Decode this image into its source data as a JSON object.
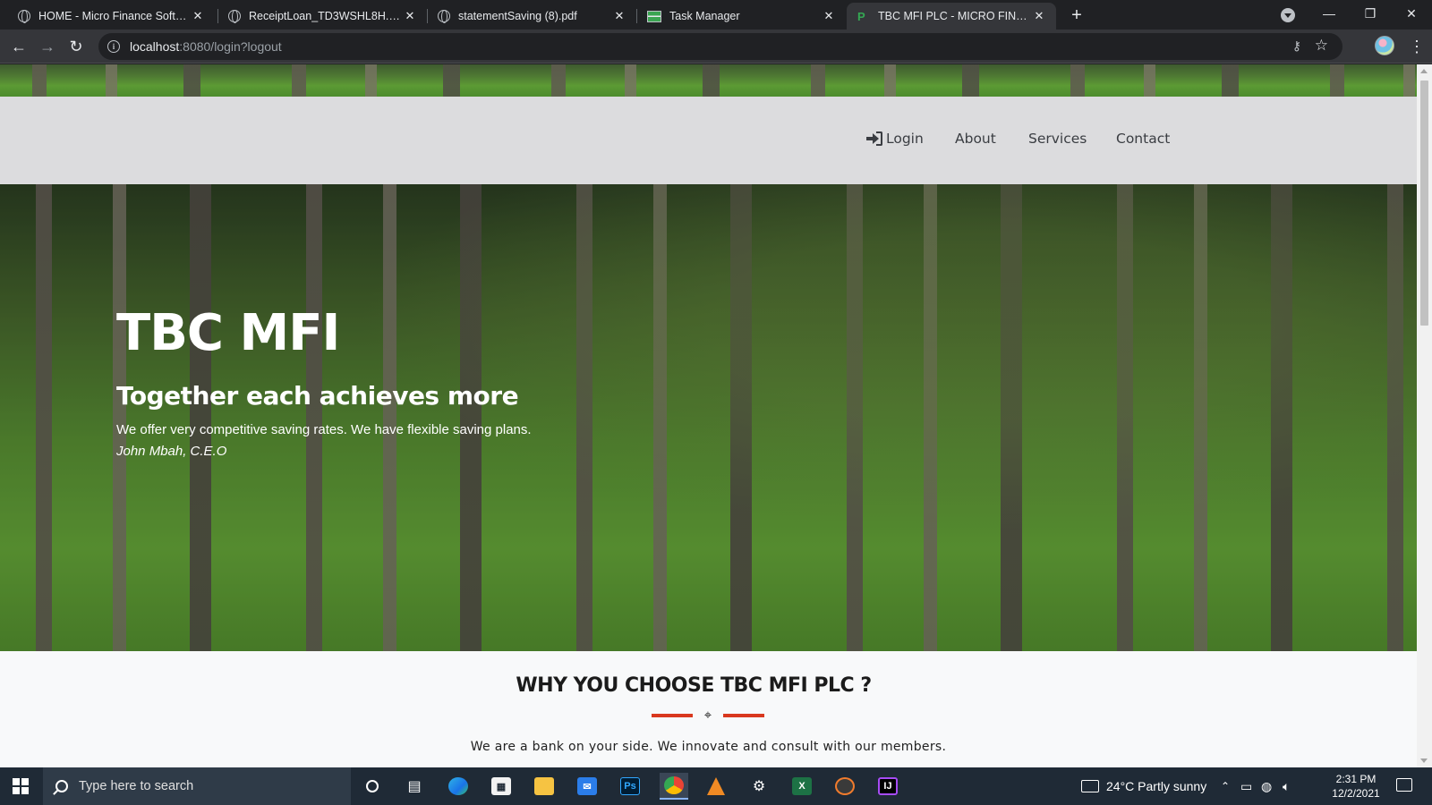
{
  "browser": {
    "tabs": [
      {
        "title": "HOME - Micro Finance Software",
        "icon": "globe-icon",
        "active": false
      },
      {
        "title": "ReceiptLoan_TD3WSHL8H.pdf",
        "icon": "globe-icon",
        "active": false
      },
      {
        "title": "statementSaving (8).pdf",
        "icon": "globe-icon",
        "active": false
      },
      {
        "title": "Task Manager",
        "icon": "task-manager-icon",
        "active": false
      },
      {
        "title": "TBC MFI PLC - MICRO FINANCE",
        "icon": "p-logo-icon",
        "active": true
      }
    ],
    "url_host": "localhost",
    "url_rest": ":8080/login?logout"
  },
  "page": {
    "nav": {
      "login": "Login",
      "about": "About",
      "services": "Services",
      "contact": "Contact"
    },
    "hero": {
      "title": "TBC MFI",
      "subtitle": "Together each achieves more",
      "text": "We offer very competitive saving rates. We have flexible saving plans.",
      "author": "John Mbah, C.E.O"
    },
    "why": {
      "title": "WHY YOU CHOOSE TBC MFI PLC ?",
      "text": "We are a bank on your side. We innovate and consult with our members."
    },
    "colors": {
      "accent": "#d9381e",
      "navbar_bg": "#dcdcde"
    }
  },
  "taskbar": {
    "search_placeholder": "Type here to search",
    "weather": "24°C  Partly sunny",
    "time": "2:31 PM",
    "date": "12/2/2021"
  }
}
